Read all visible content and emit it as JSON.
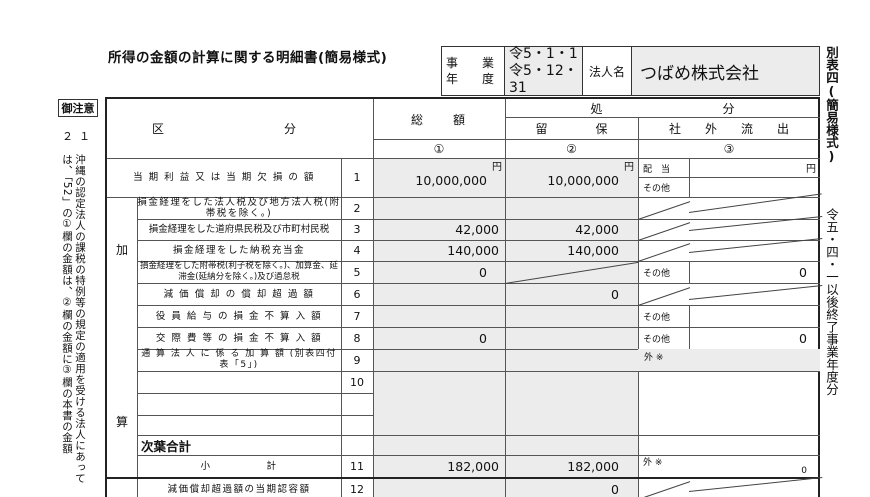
{
  "title": "所得の金額の計算に関する明細書(簡易様式)",
  "header": {
    "jigyo_label1": "事　業",
    "jigyo_label2": "年　度",
    "period_start": "令5・1・1",
    "period_end": "令5・12・31",
    "corp_label": "法人名",
    "corp_name": "つばめ株式会社"
  },
  "side_form": "別表四(簡易様式)",
  "side_period": "令五・四・一以後終了事業年度分",
  "notes": {
    "head": "御注意",
    "num": "２１",
    "text": "沖縄の認定法人の課税の特例等の規定の適用を受ける法人にあっては、「52」の①欄の金額は、②欄の金額に③欄の本書の金額"
  },
  "table": {
    "col_kubun": "区　　　　　　　　　　分",
    "col_total": "総　　額",
    "col_shobun": "処　　　　　　　　　　分",
    "col_ryuho": "留　　　　保",
    "col_shagai": "社　　外　　流　　出",
    "col_num1": "①",
    "col_num2": "②",
    "col_num3": "③",
    "yen": "円",
    "ka": "加",
    "san": "算",
    "haito": "配　当",
    "sonota": "その他",
    "gai": "外 ※",
    "rows": [
      {
        "no": "1",
        "label": "当 期 利 益 又 は 当 期 欠 損 の 額",
        "total": "10,000,000",
        "ryuho": "10,000,000",
        "shagai": ""
      },
      {
        "no": "2",
        "label": "損金経理をした法人税及び地方法人税(附帯税を除く。)",
        "total": "",
        "ryuho": "",
        "shagai": ""
      },
      {
        "no": "3",
        "label": "損金経理をした道府県民税及び市町村民税",
        "total": "42,000",
        "ryuho": "42,000",
        "shagai": ""
      },
      {
        "no": "4",
        "label": "損金経理をした納税充当金",
        "total": "140,000",
        "ryuho": "140,000",
        "shagai": ""
      },
      {
        "no": "5",
        "label": "損金経理をした附帯税(利子税を除く。)、加算金、延滞金(延納分を除く。)及び過怠税",
        "total": "0",
        "ryuho": "",
        "shagai": "0"
      },
      {
        "no": "6",
        "label": "減 価 償 却 の 償 却 超 過 額",
        "total": "",
        "ryuho": "0",
        "shagai": ""
      },
      {
        "no": "7",
        "label": "役 員 給 与 の 損 金 不 算 入 額",
        "total": "",
        "ryuho": "",
        "shagai": ""
      },
      {
        "no": "8",
        "label": "交 際 費 等 の 損 金 不 算 入 額",
        "total": "0",
        "ryuho": "",
        "shagai": "0"
      },
      {
        "no": "9",
        "label": "通 算 法 人 に 係 る 加 算 額 (別表四付表「5」)",
        "total": "",
        "ryuho": "",
        "shagai": ""
      },
      {
        "no": "10",
        "label": "",
        "total": "",
        "ryuho": "",
        "shagai": ""
      },
      {
        "no": "11",
        "label": "小　　　　　計",
        "total": "182,000",
        "ryuho": "182,000",
        "shagai": "0"
      },
      {
        "no": "12",
        "label": "減価償却超過額の当期認容額",
        "total": "",
        "ryuho": "0",
        "shagai": ""
      }
    ],
    "sub_total_label": "次葉合計"
  }
}
